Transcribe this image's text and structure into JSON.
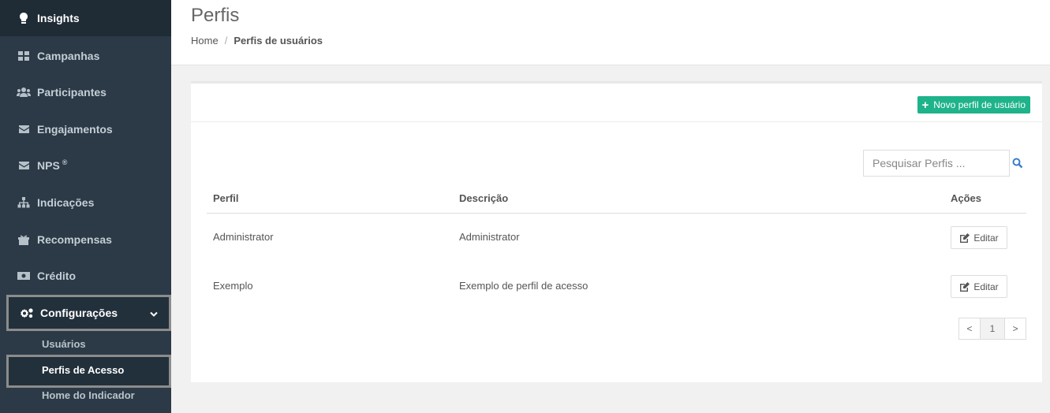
{
  "sidebar": {
    "items": [
      {
        "label": "Insights",
        "icon": "lightbulb-icon"
      },
      {
        "label": "Campanhas",
        "icon": "dashboard-icon"
      },
      {
        "label": "Participantes",
        "icon": "users-icon"
      },
      {
        "label": "Engajamentos",
        "icon": "envelope-icon"
      },
      {
        "label": "NPS",
        "icon": "envelope-icon",
        "sup": "®"
      },
      {
        "label": "Indicações",
        "icon": "sitemap-icon"
      },
      {
        "label": "Recompensas",
        "icon": "gift-icon"
      },
      {
        "label": "Crédito",
        "icon": "money-icon"
      },
      {
        "label": "Configurações",
        "icon": "gears-icon"
      }
    ],
    "submenu": [
      "Usuários",
      "Perfis de Acesso",
      "Home do Indicador"
    ]
  },
  "header": {
    "title": "Perfis",
    "breadcrumb": {
      "home": "Home",
      "separator": "/",
      "current": "Perfis de usuários"
    }
  },
  "toolbar": {
    "new_button_label": "Novo perfil de usuário"
  },
  "search": {
    "placeholder": "Pesquisar Perfis ..."
  },
  "table": {
    "headers": {
      "perfil": "Perfil",
      "descricao": "Descrição",
      "acoes": "Ações"
    },
    "rows": [
      {
        "perfil": "Administrator",
        "descricao": "Administrator",
        "action": "Editar"
      },
      {
        "perfil": "Exemplo",
        "descricao": "Exemplo de perfil de acesso",
        "action": "Editar"
      }
    ]
  },
  "pagination": {
    "prev": "<",
    "page": "1",
    "next": ">"
  },
  "colors": {
    "sidebar": "#2b3a46",
    "accent": "#1fb38b",
    "search_icon": "#3a7dc9"
  }
}
